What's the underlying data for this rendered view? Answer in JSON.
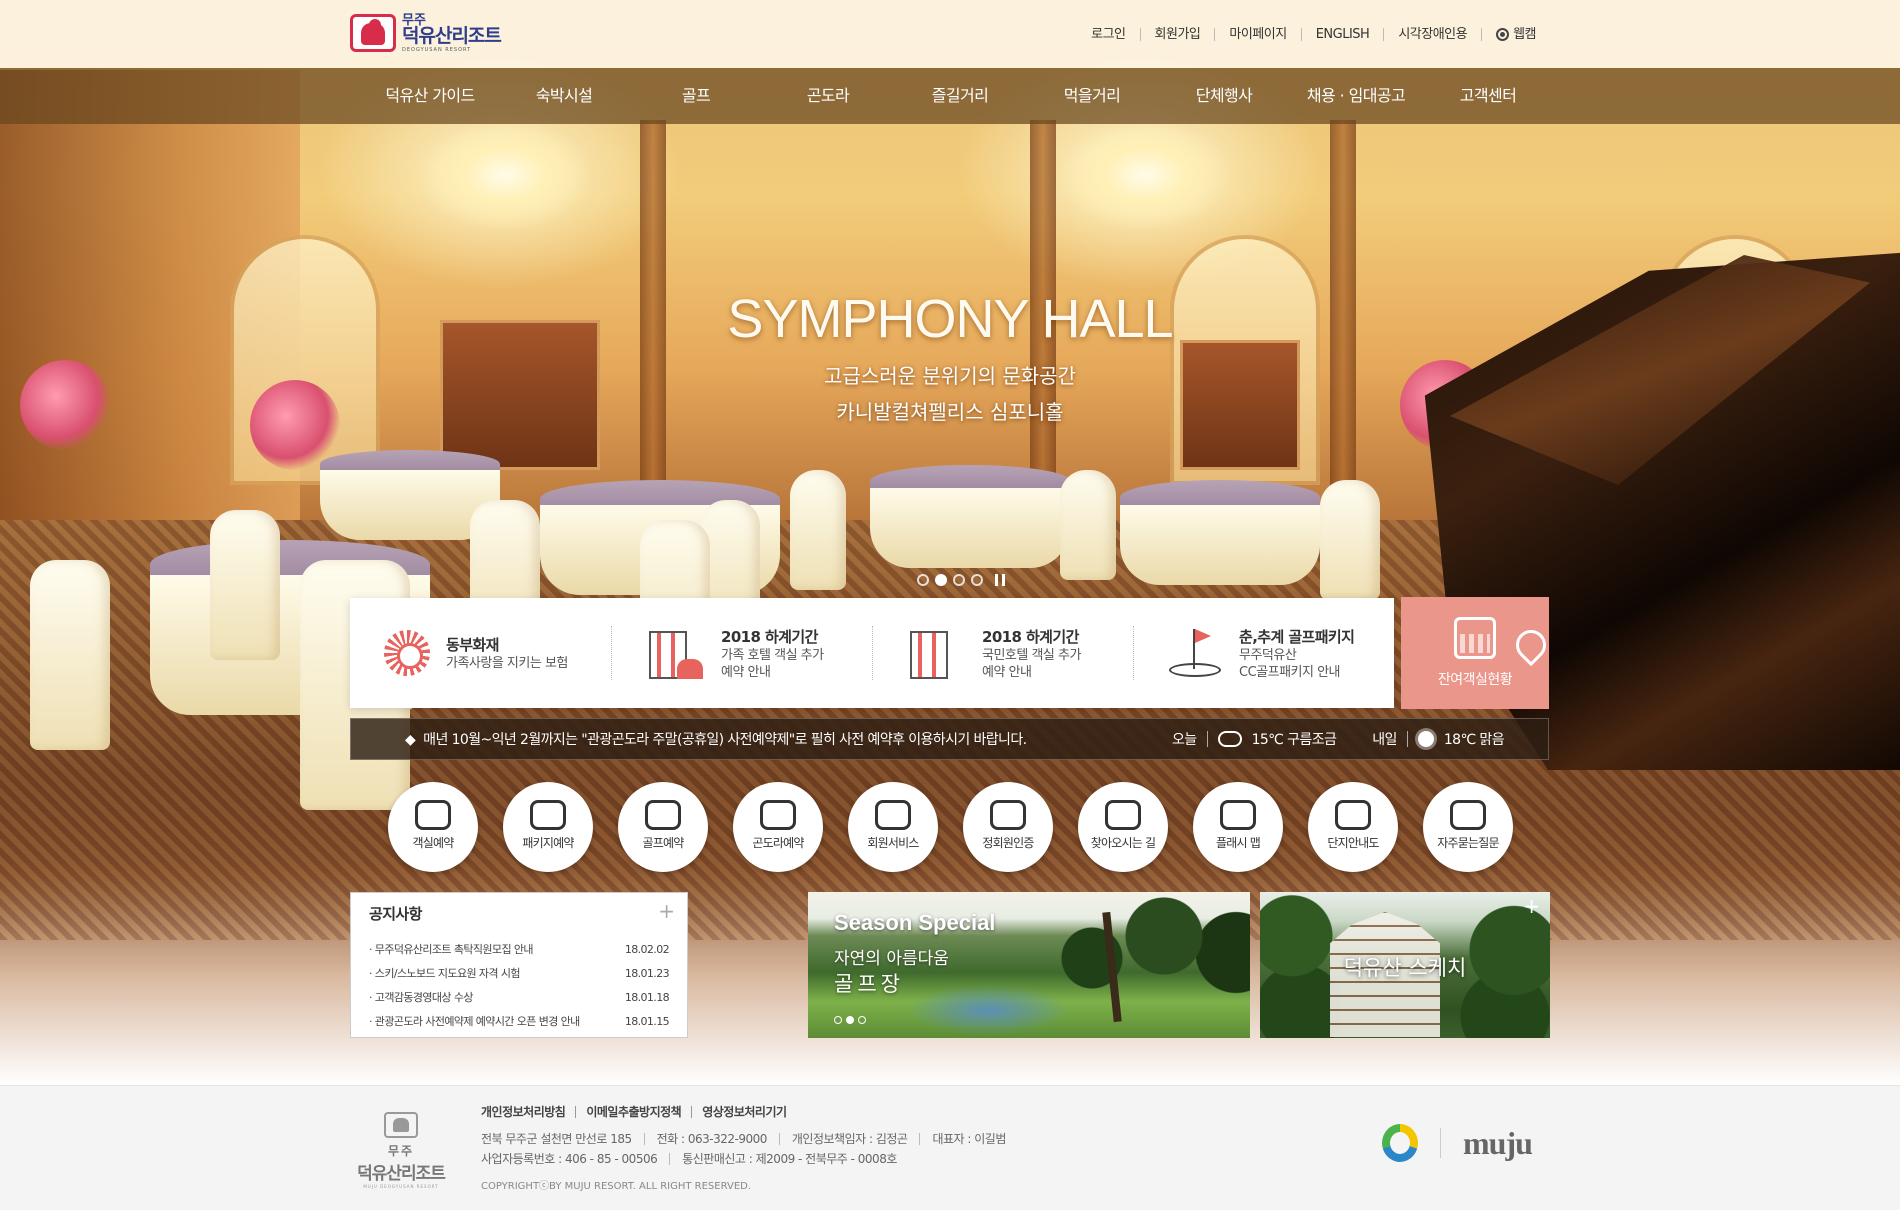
{
  "header": {
    "logo": {
      "small": "무주",
      "large": "덕유산리조트",
      "sub": "DEOGYUSAN RESORT"
    },
    "util_links": [
      "로그인",
      "회원가입",
      "마이페이지",
      "ENGLISH",
      "시각장애인용"
    ],
    "webcam_label": "웹캠"
  },
  "gnb": [
    "덕유산 가이드",
    "숙박시설",
    "골프",
    "곤도라",
    "즐길거리",
    "먹을거리",
    "단체행사",
    "채용 · 임대공고",
    "고객센터"
  ],
  "hero": {
    "title": "SYMPHONY HALL",
    "sub1": "고급스러운 분위기의 문화공간",
    "sub2": "카니발컬쳐펠리스 심포니홀",
    "slide_count": 4,
    "active_slide": 2
  },
  "promo": {
    "items": [
      {
        "icon": "sun-logo-icon",
        "title": "동부화재",
        "desc1": "가족사랑을 지키는 보험",
        "desc2": ""
      },
      {
        "icon": "hotel-family-icon",
        "title": "2018 하계기간",
        "desc1": "가족 호텔 객실 추가",
        "desc2": "예약 안내"
      },
      {
        "icon": "hotel-icon",
        "title": "2018 하계기간",
        "desc1": "국민호텔 객실 추가",
        "desc2": "예약 안내"
      },
      {
        "icon": "golf-flag-icon",
        "title": "춘,추계 골프패키지",
        "desc1": "무주덕유산",
        "desc2": "CC골프패키지 안내"
      }
    ],
    "cta_label": "잔여객실현황",
    "cta_color": "#eb968b"
  },
  "ticker": {
    "message": "매년 10월~익년 2월까지는 \"관광곤도라 주말(공휴일) 사전예약제\"로 필히 사전 예약후 이용하시기 바랍니다.",
    "weather": {
      "today_label": "오늘",
      "today": "15℃ 구름조금",
      "tomorrow_label": "내일",
      "tomorrow": "18℃ 맑음"
    }
  },
  "quick_menu": [
    {
      "label": "객실예약",
      "icon": "bed-monitor-icon"
    },
    {
      "label": "패키지예약",
      "icon": "building-icon"
    },
    {
      "label": "골프예약",
      "icon": "golf-icon"
    },
    {
      "label": "곤도라예약",
      "icon": "gondola-icon"
    },
    {
      "label": "회원서비스",
      "icon": "heart-hand-icon"
    },
    {
      "label": "정회원인증",
      "icon": "id-card-icon"
    },
    {
      "label": "찾아오시는 길",
      "icon": "map-pin-icon"
    },
    {
      "label": "플래시 맵",
      "icon": "map-icon"
    },
    {
      "label": "단지안내도",
      "icon": "signpost-icon"
    },
    {
      "label": "자주묻는질문",
      "icon": "chat-bubble-icon"
    }
  ],
  "notice": {
    "title": "공지사항",
    "items": [
      {
        "title": "무주덕유산리조트 촉탁직원모집 안내",
        "date": "18.02.02"
      },
      {
        "title": "스키/스노보드 지도요원 자격 시험",
        "date": "18.01.23"
      },
      {
        "title": "고객감동경영대상 수상",
        "date": "18.01.18"
      },
      {
        "title": "관광곤도라 사전예약제 예약시간 오픈 변경 안내",
        "date": "18.01.15"
      }
    ]
  },
  "season": {
    "title": "Season Special",
    "sub1": "자연의 아름다움",
    "sub2": "골프장",
    "slide_count": 3,
    "active_slide": 2
  },
  "sketch": {
    "title": "덕유산 스케치"
  },
  "footer": {
    "logo": {
      "small": "무주",
      "large": "덕유산리조트",
      "sub": "MUJU DEOGYUSAN RESORT"
    },
    "links": [
      "개인정보처리방침",
      "이메일추출방지정책",
      "영상정보처리기기"
    ],
    "info_row1": [
      "전북 무주군 설천면 만선로 185",
      "전화 : 063-322-9000",
      "개인정보책임자 : 김정곤",
      "대표자 : 이길범"
    ],
    "info_row2": [
      "사업자등록번호 : 406 - 85 - 00506",
      "통신판매신고 : 제2009 - 전북무주 - 0008호"
    ],
    "copyright": "COPYRIGHTⓒBY MUJU RESORT. ALL RIGHT RESERVED.",
    "brand": "muju"
  }
}
